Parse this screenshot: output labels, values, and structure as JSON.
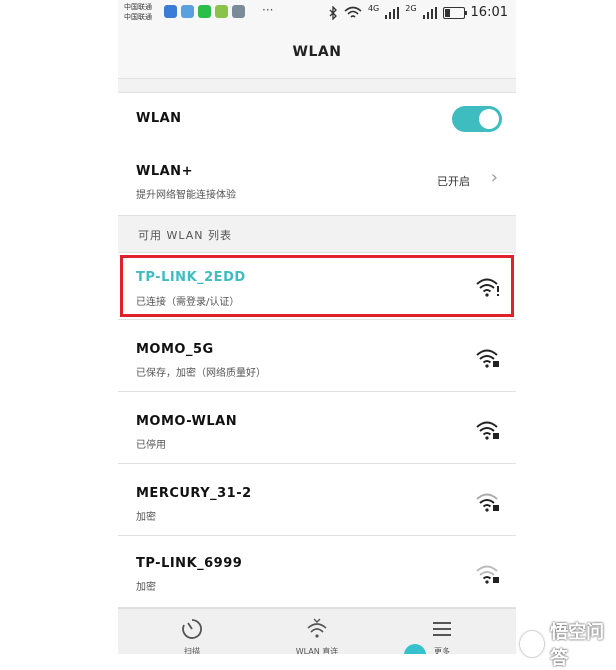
{
  "status_bar": {
    "carrier_1": "中国联通",
    "carrier_2": "中国联通",
    "dots": "···",
    "net_4g": "4G",
    "net_2g": "2G",
    "time": "16:01",
    "app_colors": [
      "#3a7bd5",
      "#5aa0e0",
      "#2bbf4a",
      "#8bc34a",
      "#7a8c99"
    ]
  },
  "header": {
    "title": "WLAN"
  },
  "settings": {
    "wlan_label": "WLAN",
    "wlan_enabled": true,
    "wlan_plus_label": "WLAN+",
    "wlan_plus_sub": "提升网络智能连接体验",
    "wlan_plus_status": "已开启"
  },
  "list_header": "可用 WLAN 列表",
  "networks": [
    {
      "name": "TP-LINK_2EDD",
      "status": "已连接（需登录/认证）",
      "connected": true
    },
    {
      "name": "MOMO_5G",
      "status": "已保存，加密（网络质量好）",
      "connected": false
    },
    {
      "name": "MOMO-WLAN",
      "status": "已停用",
      "connected": false
    },
    {
      "name": "MERCURY_31-2",
      "status": "加密",
      "connected": false
    },
    {
      "name": "TP-LINK_6999",
      "status": "加密",
      "connected": false
    }
  ],
  "bottom_nav": {
    "scan": "扫描",
    "direct": "WLAN 直连",
    "more": "更多"
  },
  "colors": {
    "accent": "#3fbcc0",
    "highlight_border": "#e0202a"
  },
  "watermark": "悟空问答"
}
